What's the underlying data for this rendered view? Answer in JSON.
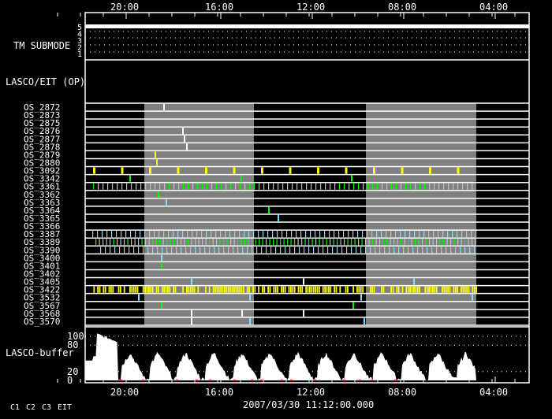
{
  "chart_data": {
    "type": "timeline",
    "title": "LASCO/EIT timeline",
    "time_axis": {
      "ticks": [
        "20:00",
        "16:00",
        "12:00",
        "08:00",
        "04:00"
      ],
      "direction": "reversed"
    },
    "date_label": "2007/03/30 11:12:00.000",
    "tm_submode": {
      "label": "TM SUBMODE",
      "ticks": [
        "5",
        "4",
        "3",
        "2",
        "1"
      ],
      "value": 5
    },
    "op_section_label": "LASCO/EIT (OP)",
    "rows": [
      "OS_2872",
      "OS_2873",
      "OS_2875",
      "OS_2876",
      "OS_2877",
      "OS_2878",
      "OS_2879",
      "OS_2880",
      "OS_3092",
      "OS_3342",
      "OS_3361",
      "OS_3362",
      "OS_3363",
      "OS_3364",
      "OS_3365",
      "OS_3366",
      "OS_3387",
      "OS_3389",
      "OS_3390",
      "OS_3400",
      "OS_3401",
      "OS_3402",
      "OS_3405",
      "OS_3422",
      "OS_3532",
      "OS_3567",
      "OS_3568",
      "OS_3570"
    ],
    "buffer": {
      "label": "LASCO-buffer",
      "ticks": [
        "100",
        "80",
        "20",
        "0"
      ],
      "ylim": [
        0,
        110
      ]
    },
    "legend": [
      {
        "label": "C1",
        "color": "#ff0000"
      },
      {
        "label": "C2",
        "color": "#00ff00"
      },
      {
        "label": "C3",
        "color": "#80e0ff"
      },
      {
        "label": "EIT",
        "color": "#ffff00"
      }
    ]
  }
}
